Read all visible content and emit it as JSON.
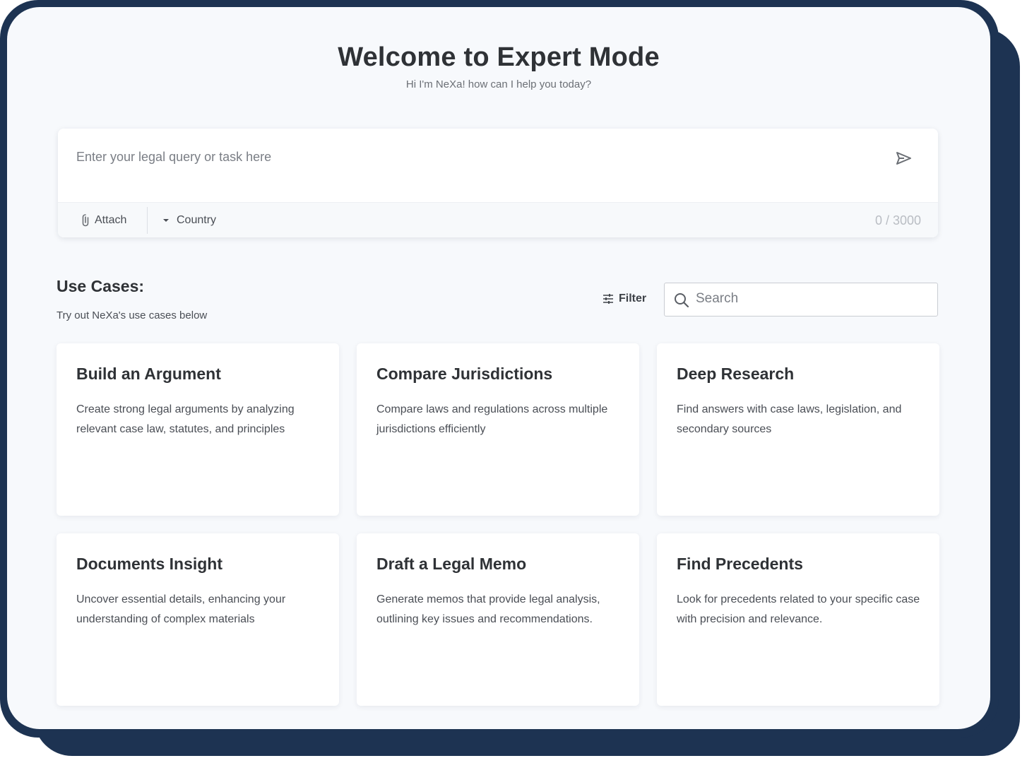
{
  "header": {
    "title": "Welcome to Expert Mode",
    "subtitle": "Hi I'm NeXa! how can I help you today?"
  },
  "query": {
    "placeholder": "Enter your legal query or task here",
    "value": "",
    "attach_label": "Attach",
    "country_label": "Country",
    "char_count": "0 / 3000",
    "send_icon": "send-icon"
  },
  "use_cases": {
    "heading": "Use Cases:",
    "subheading": "Try out NeXa's use cases below",
    "filter_label": "Filter",
    "search_placeholder": "Search",
    "cards": [
      {
        "title": "Build an Argument",
        "description": "Create strong legal arguments by analyzing relevant case law, statutes, and principles"
      },
      {
        "title": "Compare Jurisdictions",
        "description": "Compare laws and regulations across multiple jurisdictions efficiently"
      },
      {
        "title": "Deep Research",
        "description": "Find answers with case laws, legislation, and secondary sources"
      },
      {
        "title": "Documents Insight",
        "description": "Uncover essential details, enhancing your understanding of complex materials"
      },
      {
        "title": "Draft a Legal Memo",
        "description": "Generate memos that provide legal analysis, outlining key issues and recommendations."
      },
      {
        "title": "Find Precedents",
        "description": "Look for precedents related to your specific case with precision and relevance."
      }
    ]
  },
  "colors": {
    "frame_border": "#1d3352",
    "background": "#f7f9fc",
    "card_background": "#ffffff",
    "text_primary": "#2f3236",
    "text_secondary": "#4a4e55"
  }
}
